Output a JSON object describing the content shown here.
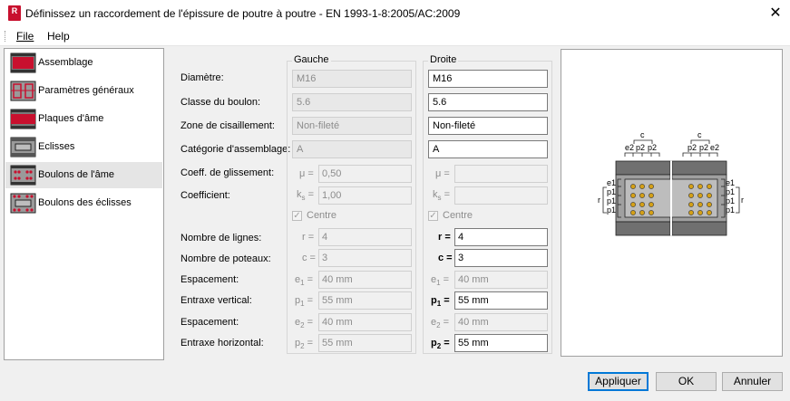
{
  "window": {
    "title": "Définissez un raccordement de l'épissure de poutre à poutre - EN 1993-1-8:2005/AC:2009",
    "icon_letter": "R",
    "close_glyph": "✕"
  },
  "menu": {
    "file": "File",
    "help": "Help"
  },
  "sidebar": {
    "items": [
      {
        "label": "Assemblage"
      },
      {
        "label": "Paramètres généraux"
      },
      {
        "label": "Plaques d'âme"
      },
      {
        "label": "Eclisses"
      },
      {
        "label": "Boulons de l'âme",
        "selected": true
      },
      {
        "label": "Boulons des éclisses"
      }
    ]
  },
  "groups": {
    "left": "Gauche",
    "right": "Droite"
  },
  "labels": {
    "diameter": "Diamètre:",
    "bolt_class": "Classe du boulon:",
    "shear_zone": "Zone de cisaillement:",
    "category": "Catégorie d'assemblage:",
    "slip_coeff": "Coeff. de glissement:",
    "coeff": "Coefficient:",
    "rows": "Nombre de lignes:",
    "columns": "Nombre de poteaux:",
    "spacing1": "Espacement:",
    "pitch_v": "Entraxe vertical:",
    "spacing2": "Espacement:",
    "pitch_h": "Entraxe horizontal:"
  },
  "symbols": {
    "mu": "μ =",
    "ks": "k",
    "ks_sub": "s",
    "eq": "=",
    "r": "r =",
    "c": "c =",
    "e": "e",
    "p": "p",
    "sub1": "1",
    "sub2": "2"
  },
  "left": {
    "diameter": "M16",
    "bolt_class": "5.6",
    "shear_zone": "Non-fileté",
    "category": "A",
    "mu": "0,50",
    "ks": "1,00",
    "centre": "Centre",
    "rows": "4",
    "columns": "3",
    "e1": "40 mm",
    "p1": "55 mm",
    "e2": "40 mm",
    "p2": "55 mm"
  },
  "right": {
    "diameter": "M16",
    "bolt_class": "5.6",
    "shear_zone": "Non-fileté",
    "category": "A",
    "mu": "",
    "ks": "",
    "centre": "Centre",
    "rows": "4",
    "columns": "3",
    "e1": "40 mm",
    "p1": "55 mm",
    "e2": "40 mm",
    "p2": "55 mm"
  },
  "diagram": {
    "c_left": "c",
    "c_right": "c",
    "top_left": [
      "e2",
      "p2",
      "p2"
    ],
    "top_right": [
      "p2",
      "p2",
      "e2"
    ],
    "side_right": [
      "e1",
      "p1",
      "p1",
      "p1"
    ],
    "side_left": [
      "e1",
      "p1",
      "p1",
      "p1"
    ],
    "r_left": "r",
    "r_right": "r"
  },
  "buttons": {
    "apply": "Appliquer",
    "ok": "OK",
    "cancel": "Annuler"
  },
  "colors": {
    "accent": "#0078d7",
    "bolt": "#d4a017",
    "red": "#c8102e"
  }
}
